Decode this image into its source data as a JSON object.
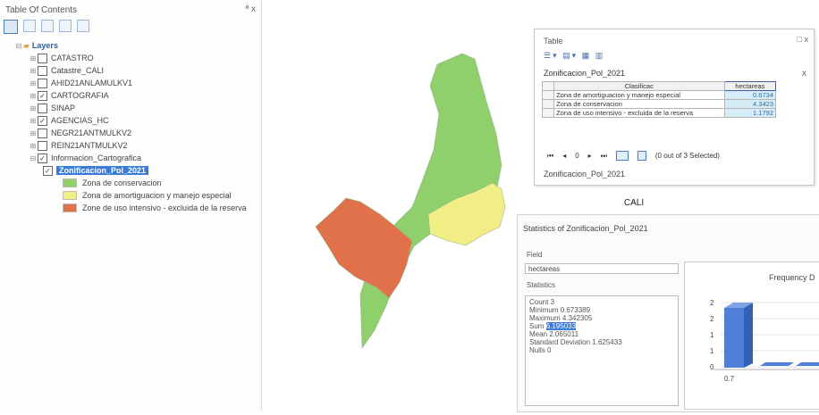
{
  "toc": {
    "title": "Table Of Contents",
    "controls": "ª x",
    "layers_label": "Layers",
    "items": [
      {
        "label": "CATASTRO",
        "checked": false
      },
      {
        "label": "Catastre_CALI",
        "checked": false
      },
      {
        "label": "AHID21ANLAMULKV1",
        "checked": false
      },
      {
        "label": "CARTOGRAFIA",
        "checked": true
      },
      {
        "label": "SINAP",
        "checked": false
      },
      {
        "label": "AGENCIAS_HC",
        "checked": true
      },
      {
        "label": "NEGR21ANTMULKV2",
        "checked": false
      },
      {
        "label": "REIN21ANTMULKV2",
        "checked": false
      },
      {
        "label": "Informacion_Cartografica",
        "checked": true
      }
    ],
    "selected_layer": "Zonificacion_Pol_2021",
    "legend": [
      {
        "label": "Zona de conservacion",
        "color": "#8fcf6c"
      },
      {
        "label": "Zona de amortiguacion y manejo especial",
        "color": "#f2ee86"
      },
      {
        "label": "Zone de uso intensivo - excluida de la reserva",
        "color": "#e0714a"
      }
    ]
  },
  "map": {
    "colors": {
      "conservacion": "#8fcf6c",
      "amortiguacion": "#f2ee86",
      "intensivo": "#e0714a"
    }
  },
  "table": {
    "title": "Table",
    "window_controls": "□ x",
    "tab_name": "Zonificacion_Pol_2021",
    "tab_close": "x",
    "col_class": "Clasificac",
    "col_ha": "hectareas",
    "rows": [
      {
        "name": "Zona de amortiguacion y manejo especial",
        "value": "0.6734"
      },
      {
        "name": "Zona de conservacion",
        "value": "4.3423"
      },
      {
        "name": "Zona de uso intensivo - excluida de la reserva",
        "value": "1.1792"
      }
    ],
    "nav_text": "(0 out of 3 Selected)",
    "record_number": "0",
    "footer": "Zonificacion_Pol_2021"
  },
  "stats": {
    "map_title": "CALI",
    "title": "Statistics of Zonificacion_Pol_2021",
    "field_label": "Field",
    "field_value": "hectareas",
    "statistics_label": "Statistics",
    "lines": [
      {
        "k": "Count",
        "v": "3"
      },
      {
        "k": "Minimum",
        "v": "0.673389"
      },
      {
        "k": "Maximum",
        "v": "4.342305"
      },
      {
        "k": "Sum",
        "v": "6.195033"
      },
      {
        "k": "Mean",
        "v": "2.065011"
      },
      {
        "k": "Standard Deviation",
        "v": "1.625433"
      },
      {
        "k": "Nulls",
        "v": "0"
      }
    ],
    "freq_title": "Frequency D",
    "freq_y_labels": [
      "2",
      "2",
      "1",
      "1",
      "0"
    ],
    "freq_x_label": "0.7",
    "bar_color": "#4f7fd6"
  }
}
